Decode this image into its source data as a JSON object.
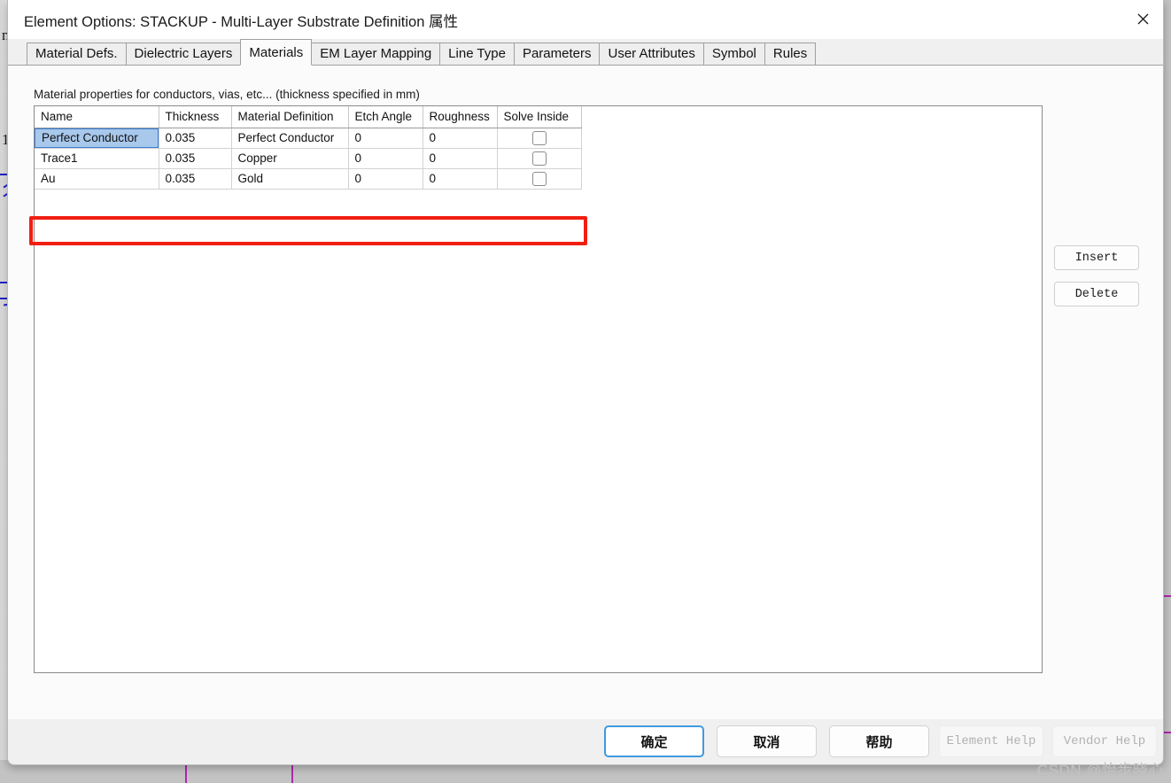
{
  "window": {
    "title": "Element Options: STACKUP - Multi-Layer Substrate Definition 属性",
    "close_icon": "close-icon"
  },
  "tabs": [
    {
      "label": "Material Defs.",
      "active": false
    },
    {
      "label": "Dielectric Layers",
      "active": false
    },
    {
      "label": "Materials",
      "active": true
    },
    {
      "label": "EM Layer Mapping",
      "active": false
    },
    {
      "label": "Line Type",
      "active": false
    },
    {
      "label": "Parameters",
      "active": false
    },
    {
      "label": "User Attributes",
      "active": false
    },
    {
      "label": "Symbol",
      "active": false
    },
    {
      "label": "Rules",
      "active": false
    }
  ],
  "panel": {
    "caption": "Material properties for conductors, vias, etc... (thickness specified in mm)"
  },
  "table": {
    "columns": [
      "Name",
      "Thickness",
      "Material Definition",
      "Etch Angle",
      "Roughness",
      "Solve Inside"
    ],
    "rows": [
      {
        "name": "Perfect Conductor",
        "thickness": "0.035",
        "material_definition": "Perfect Conductor",
        "etch_angle": "0",
        "roughness": "0",
        "solve_inside": false,
        "selected": true
      },
      {
        "name": "Trace1",
        "thickness": "0.035",
        "material_definition": "Copper",
        "etch_angle": "0",
        "roughness": "0",
        "solve_inside": false,
        "selected": false
      },
      {
        "name": "Au",
        "thickness": "0.035",
        "material_definition": "Gold",
        "etch_angle": "0",
        "roughness": "0",
        "solve_inside": false,
        "selected": false
      }
    ]
  },
  "side_buttons": {
    "insert": "Insert",
    "delete": "Delete"
  },
  "footer": {
    "ok": "确定",
    "cancel": "取消",
    "help": "帮助",
    "element_help": "Element Help",
    "vendor_help": "Vendor Help"
  },
  "annotation": {
    "highlight_color": "#f01f12",
    "highlight_target_row": "Trace1"
  },
  "watermark": "CSDN @怡步晓心",
  "colors": {
    "accent": "#3f9ae0",
    "selection": "#a8c8ec",
    "selection_border": "#3a7fd5",
    "annotation": "#f01f12",
    "dialog_bg": "#f0f0f0",
    "panel_bg": "#fbfbfb"
  }
}
